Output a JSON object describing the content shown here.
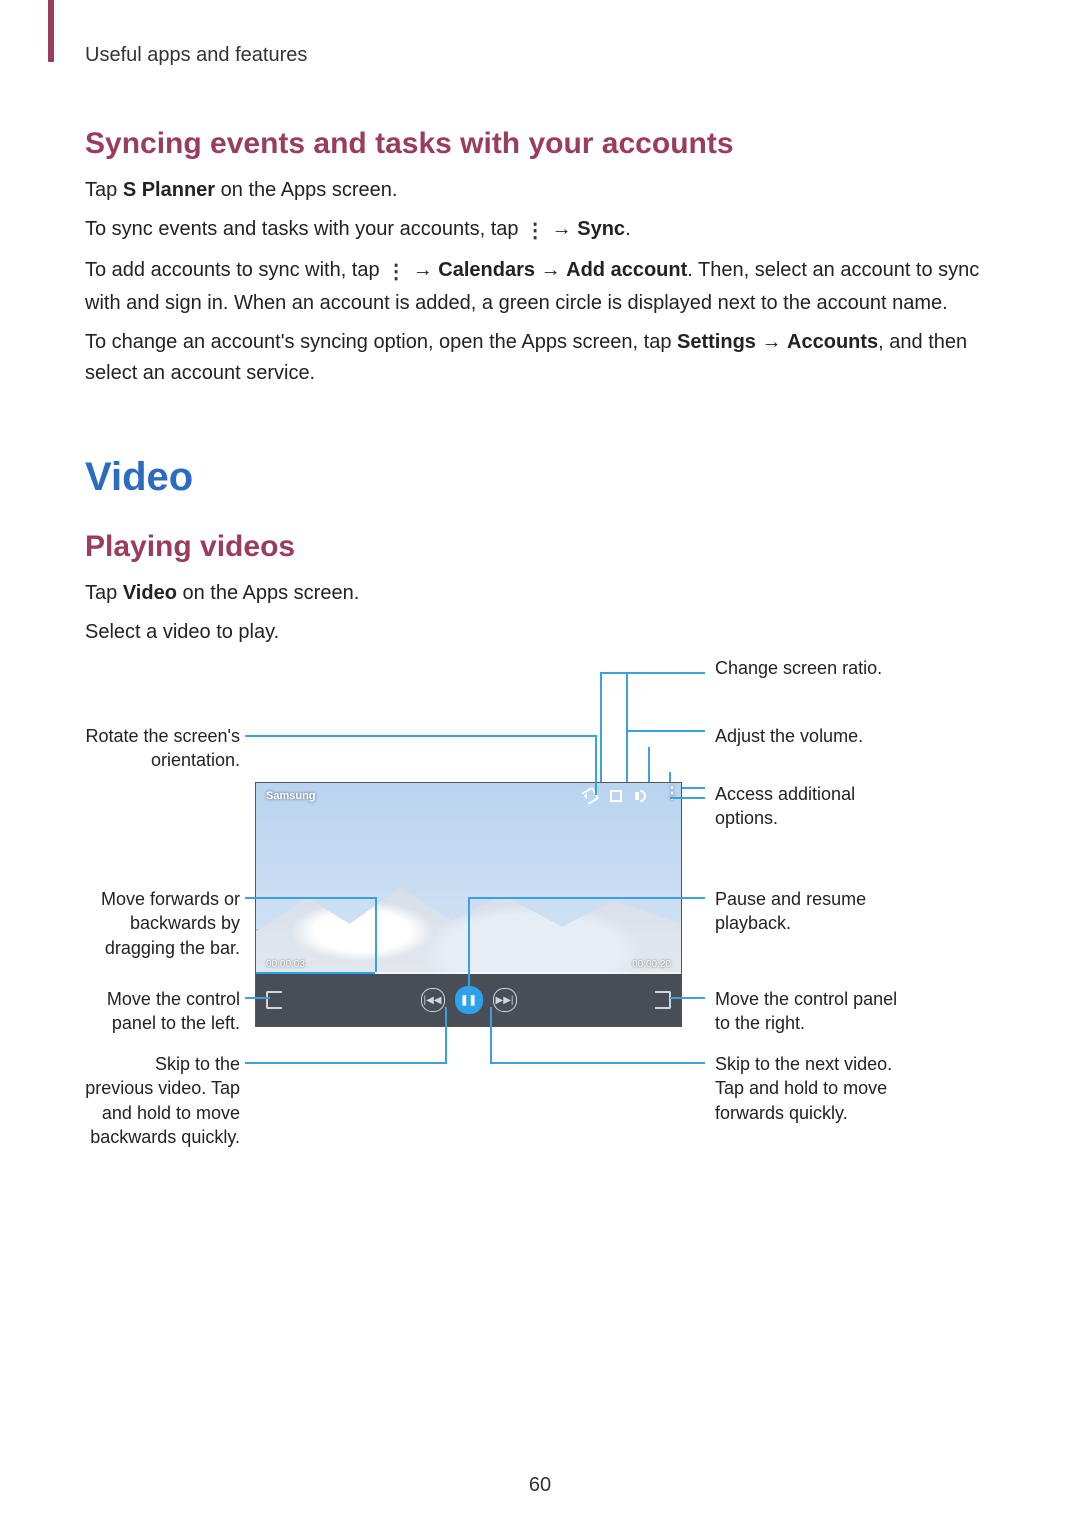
{
  "running_header": "Useful apps and features",
  "page_number": "60",
  "sync": {
    "heading": "Syncing events and tasks with your accounts",
    "p1a": "Tap ",
    "p1b": "S Planner",
    "p1c": " on the Apps screen.",
    "p2a": "To sync events and tasks with your accounts, tap ",
    "p2b": " → ",
    "p2c": "Sync",
    "p2d": ".",
    "p3a": "To add accounts to sync with, tap ",
    "p3b": " → ",
    "p3c": "Calendars",
    "p3d": " → ",
    "p3e": "Add account",
    "p3f": ". Then, select an account to sync with and sign in. When an account is added, a green circle is displayed next to the account name.",
    "p4a": "To change an account's syncing option, open the Apps screen, tap ",
    "p4b": "Settings",
    "p4c": " → ",
    "p4d": "Accounts",
    "p4e": ", and then select an account service."
  },
  "video": {
    "h1": "Video",
    "h2": "Playing videos",
    "p1a": "Tap ",
    "p1b": "Video",
    "p1c": " on the Apps screen.",
    "p2": "Select a video to play."
  },
  "player": {
    "title": "Samsung",
    "time_elapsed": "00:00:03",
    "time_total": "00:00:20"
  },
  "callouts": {
    "rotate": "Rotate the screen's orientation.",
    "seek": "Move forwards or backwards by dragging the bar.",
    "panel_left": "Move the control panel to the left.",
    "skip_prev": "Skip to the previous video. Tap and hold to move backwards quickly.",
    "ratio": "Change screen ratio.",
    "volume": "Adjust the volume.",
    "options": "Access additional options.",
    "pause": "Pause and resume playback.",
    "panel_right": "Move the control panel to the right.",
    "skip_next": "Skip to the next video. Tap and hold to move forwards quickly."
  }
}
